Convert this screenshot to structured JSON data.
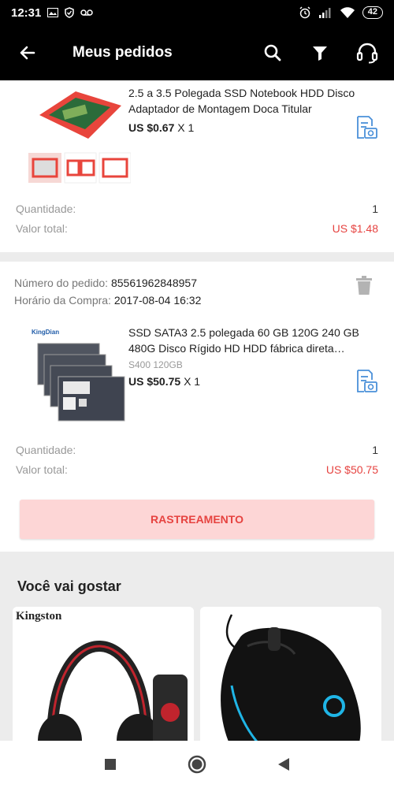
{
  "status_bar": {
    "time": "12:31",
    "battery": "42"
  },
  "header": {
    "title": "Meus pedidos"
  },
  "order1": {
    "product_name": "2.5 a 3.5 Polegada SSD Notebook HDD Disco Adaptador de Montagem Doca Titular",
    "price": "US $0.67",
    "qty_text": "X 1",
    "quantity_label": "Quantidade:",
    "quantity_value": "1",
    "total_label": "Valor total:",
    "total_value": "US $1.48"
  },
  "order2": {
    "order_number_label": "Número do pedido:",
    "order_number": "85561962848957",
    "purchase_time_label": "Horário da Compra:",
    "purchase_time": "2017-08-04 16:32",
    "product_name": "SSD SATA3 2.5 polegada 60 GB 120G 240 GB 480G Disco Rígido HD HDD fábrica direta…",
    "variant": "S400 120GB",
    "price": "US $50.75",
    "qty_text": "X 1",
    "quantity_label": "Quantidade:",
    "quantity_value": "1",
    "total_label": "Valor total:",
    "total_value": "US $50.75",
    "track_button": "RASTREAMENTO",
    "brand_label": "KingDian"
  },
  "recommendations": {
    "title": "Você vai gostar",
    "items": [
      {
        "brand": "Kingston"
      },
      {
        "brand": ""
      }
    ]
  },
  "colors": {
    "accent": "#e64340",
    "track_bg": "#fdd6d6",
    "review_icon": "#4a90d9"
  }
}
